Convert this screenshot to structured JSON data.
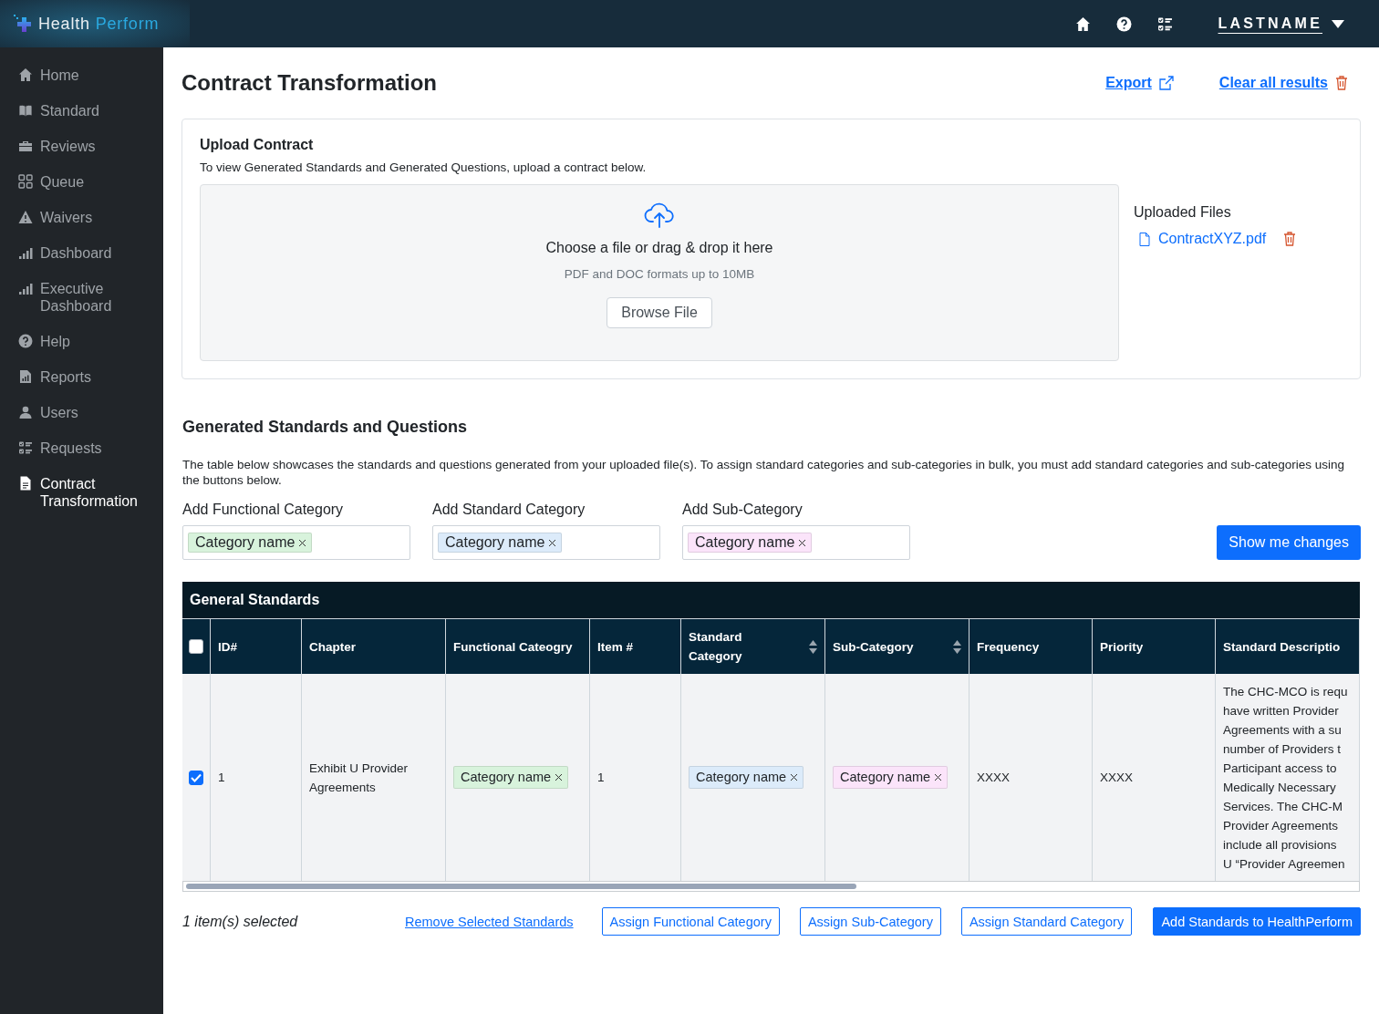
{
  "app": {
    "logo_first": "Health",
    "logo_second": "Perform"
  },
  "topbar": {
    "user": "LASTNAME"
  },
  "sidebar": {
    "items": [
      {
        "label": "Home",
        "selected": false
      },
      {
        "label": "Standard",
        "selected": false
      },
      {
        "label": "Reviews",
        "selected": false
      },
      {
        "label": "Queue",
        "selected": false
      },
      {
        "label": "Waivers",
        "selected": false
      },
      {
        "label": "Dashboard",
        "selected": false
      },
      {
        "label": "Executive Dashboard",
        "selected": false
      },
      {
        "label": "Help",
        "selected": false
      },
      {
        "label": "Reports",
        "selected": false
      },
      {
        "label": "Users",
        "selected": false
      },
      {
        "label": "Requests",
        "selected": false
      },
      {
        "label": "Contract Transformation",
        "selected": true
      }
    ]
  },
  "page": {
    "title": "Contract Transformation",
    "export": "Export",
    "clear": "Clear all results"
  },
  "upload": {
    "title": "Upload Contract",
    "hint": "To view Generated Standards and Generated Questions, upload a contract below.",
    "drop_text": "Choose a file or drag & drop it here",
    "formats": "PDF and DOC formats up to 10MB",
    "browse": "Browse File",
    "uploaded_title": "Uploaded Files",
    "files": [
      "ContractXYZ.pdf"
    ]
  },
  "generated": {
    "title": "Generated Standards and Questions",
    "description": "The table below showcases the standards and questions generated from your uploaded file(s). To assign standard categories and sub-categories in bulk, you must add standard categories and sub-categories using the buttons below.",
    "category_fields": [
      {
        "label": "Add Functional Category",
        "tags": [
          {
            "label": "Category name",
            "color": "#d8f3dc"
          }
        ]
      },
      {
        "label": "Add Standard Category",
        "tags": [
          {
            "label": "Category name",
            "color": "#dcebfa"
          }
        ]
      },
      {
        "label": "Add Sub-Category",
        "tags": [
          {
            "label": "Category name",
            "color": "#fbe4fa"
          }
        ]
      }
    ],
    "show_changes": "Show me changes"
  },
  "table": {
    "title": "General Standards",
    "all_checked": false,
    "columns": [
      {
        "label": "ID#",
        "sortable": false
      },
      {
        "label": "Chapter",
        "sortable": false
      },
      {
        "label": "Functional Cateogry",
        "sortable": false
      },
      {
        "label": "Item #",
        "sortable": false
      },
      {
        "label": "Standard Category",
        "sortable": true
      },
      {
        "label": "Sub-Category",
        "sortable": true
      },
      {
        "label": "Frequency",
        "sortable": false
      },
      {
        "label": "Priority",
        "sortable": false
      },
      {
        "label": "Standard Descriptio",
        "sortable": false
      }
    ],
    "rows": [
      {
        "checked": true,
        "cells": [
          {
            "kind": "text",
            "text": "1"
          },
          {
            "kind": "text",
            "text": "Exhibit U Provider Agreements"
          },
          {
            "kind": "tag",
            "text": "Category name",
            "color": "#d8f3dc"
          },
          {
            "kind": "text",
            "text": "1"
          },
          {
            "kind": "tag",
            "text": "Category name",
            "color": "#dcebfa"
          },
          {
            "kind": "tag",
            "text": "Category name",
            "color": "#fbe4fa"
          },
          {
            "kind": "text",
            "text": "XXXX"
          },
          {
            "kind": "text",
            "text": "XXXX"
          },
          {
            "kind": "block",
            "text": "The CHC-MCO is requ\nhave written Provider\nAgreements with a su\nnumber of Providers t\nParticipant access to\nMedically Necessary\nServices. The CHC-M\nProvider Agreements\ninclude all provisions\nU “Provider Agreemen"
          }
        ]
      }
    ]
  },
  "footer": {
    "selected_count": "1 item(s) selected",
    "link": "Remove Selected Standards",
    "buttons": [
      {
        "label": "Assign Functional Category",
        "kind": "outline"
      },
      {
        "label": "Assign Sub-Category",
        "kind": "outline"
      },
      {
        "label": "Assign Standard Category",
        "kind": "outline"
      },
      {
        "label": "Add Standards to HealthPerform",
        "kind": "primary"
      }
    ]
  }
}
